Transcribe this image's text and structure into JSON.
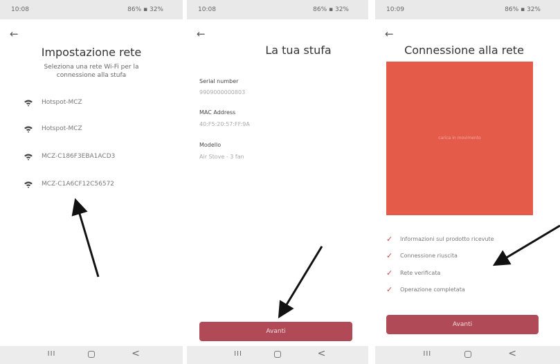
{
  "screen1": {
    "status": {
      "time": "10:08",
      "indicators": "86% ▪ 32%"
    },
    "title": "Impostazione rete",
    "subtitle": "Seleziona una rete Wi-Fi per la connessione alla stufa",
    "networks": [
      "Hotspot-MCZ",
      "Hotspot-MCZ",
      "MCZ-C186F3EBA1ACD3",
      "MCZ-C1A6CF12C56572"
    ]
  },
  "screen2": {
    "status": {
      "time": "10:08",
      "indicators": "86% ▪ 32%"
    },
    "title": "La tua stufa",
    "fields": [
      {
        "label": "Serial number",
        "value": "9909000000803"
      },
      {
        "label": "MAC Address",
        "value": "40:F5:20:57:FF:9A"
      },
      {
        "label": "Modello",
        "value": "Air Stove - 3 fan"
      }
    ],
    "next_label": "Avanti"
  },
  "screen3": {
    "status": {
      "time": "10:09",
      "indicators": "86% ▪ 32%"
    },
    "title": "Connessione alla rete",
    "video_caption": "carica in movimento",
    "checklist": [
      "Informazioni sul prodotto ricevute",
      "Connessione riuscita",
      "Rete verificata",
      "Operazione completata"
    ],
    "next_label": "Avanti"
  },
  "navbar": {
    "recent": "III",
    "back": "<"
  },
  "colors": {
    "accent": "#b04a57",
    "video": "#e55b4a",
    "check": "#c4454b"
  }
}
